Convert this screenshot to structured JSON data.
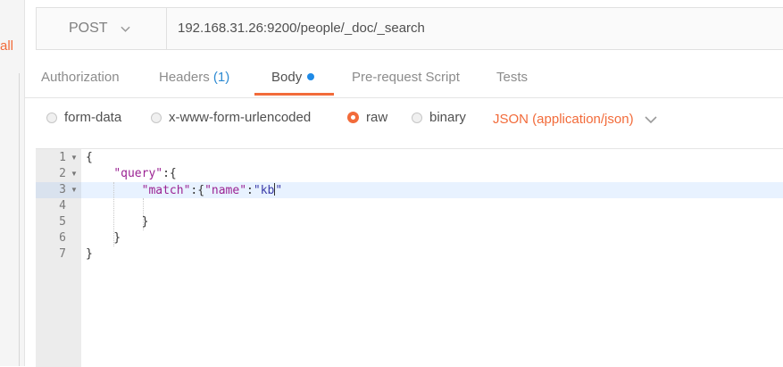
{
  "sidebar": {
    "all_label": "all"
  },
  "request": {
    "method": "POST",
    "url": "192.168.31.26:9200/people/_doc/_search"
  },
  "tabs": [
    {
      "label": "Authorization"
    },
    {
      "label": "Headers",
      "count": "(1)"
    },
    {
      "label": "Body",
      "active": true
    },
    {
      "label": "Pre-request Script"
    },
    {
      "label": "Tests"
    }
  ],
  "body_types": [
    {
      "label": "form-data",
      "checked": false
    },
    {
      "label": "x-www-form-urlencoded",
      "checked": false
    },
    {
      "label": "raw",
      "checked": true
    },
    {
      "label": "binary",
      "checked": false
    }
  ],
  "content_type": "JSON (application/json)",
  "editor": {
    "line_numbers": [
      "1",
      "2",
      "3",
      "4",
      "5",
      "6",
      "7"
    ],
    "lines": [
      {
        "parts": [
          {
            "t": "{",
            "c": "plain"
          }
        ]
      },
      {
        "parts": [
          {
            "t": "    ",
            "c": "plain"
          },
          {
            "t": "\"query\"",
            "c": "key"
          },
          {
            "t": ":{",
            "c": "plain"
          }
        ]
      },
      {
        "parts": [
          {
            "t": "        ",
            "c": "plain"
          },
          {
            "t": "\"match\"",
            "c": "key"
          },
          {
            "t": ":{",
            "c": "plain"
          },
          {
            "t": "\"name\"",
            "c": "key"
          },
          {
            "t": ":",
            "c": "plain"
          },
          {
            "t": "\"kb\"",
            "c": "str"
          }
        ]
      },
      {
        "parts": [
          {
            "t": "",
            "c": "plain"
          }
        ]
      },
      {
        "parts": [
          {
            "t": "        }",
            "c": "plain"
          }
        ]
      },
      {
        "parts": [
          {
            "t": "    }",
            "c": "plain"
          }
        ]
      },
      {
        "parts": [
          {
            "t": "}",
            "c": "plain"
          }
        ]
      }
    ],
    "highlighted_line": "3",
    "colors": {
      "key": "#9b2393",
      "string": "#3b3ba8",
      "accent": "#f26b3a",
      "blue": "#2d8ad2"
    }
  }
}
